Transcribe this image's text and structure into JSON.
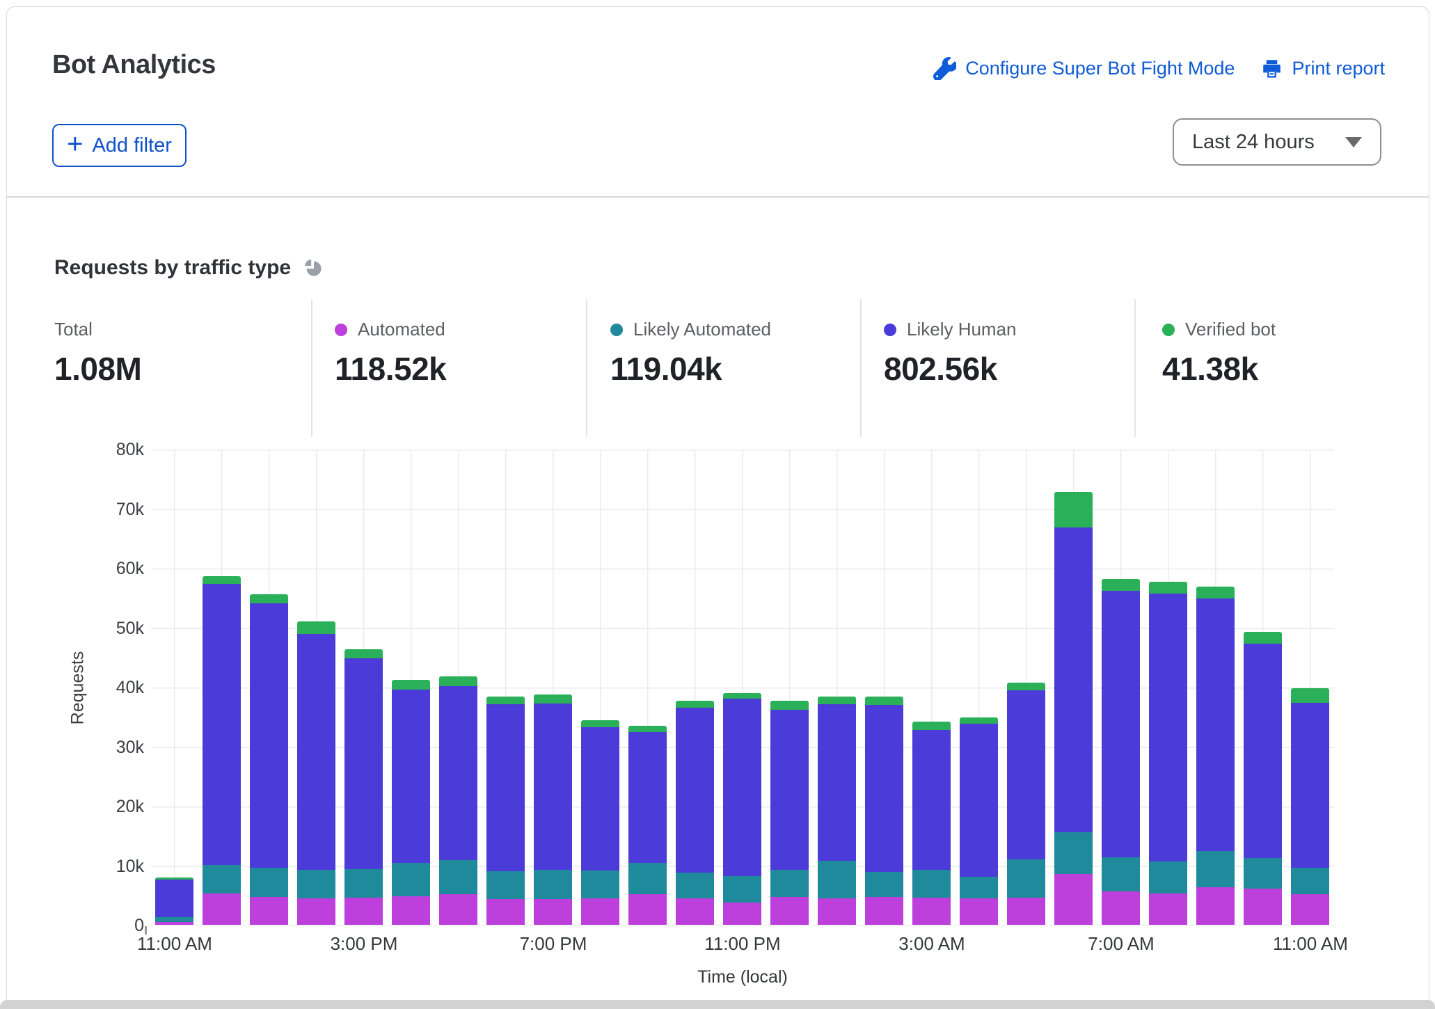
{
  "header": {
    "title": "Bot Analytics",
    "configure_link": "Configure Super Bot Fight Mode",
    "print_link": "Print report",
    "add_filter_label": "Add filter",
    "time_range": "Last 24 hours"
  },
  "section": {
    "title": "Requests by traffic type"
  },
  "stats": [
    {
      "label": "Total",
      "value": "1.08M",
      "dot": null
    },
    {
      "label": "Automated",
      "value": "118.52k",
      "dot": "#bd3fdc"
    },
    {
      "label": "Likely Automated",
      "value": "119.04k",
      "dot": "#1f8a9b"
    },
    {
      "label": "Likely Human",
      "value": "802.56k",
      "dot": "#4b3bd8"
    },
    {
      "label": "Verified bot",
      "value": "41.38k",
      "dot": "#2bb05a"
    }
  ],
  "colors": {
    "link_blue": "#0f5bd8",
    "grid": "#ebebeb",
    "pie_icon_gray": "#9aa0a5"
  },
  "chart_data": {
    "type": "bar",
    "stacked": true,
    "title": "Requests by traffic type",
    "xlabel": "Time (local)",
    "ylabel": "Requests",
    "ylim": [
      0,
      80000
    ],
    "yticks": [
      "0",
      "10k",
      "20k",
      "30k",
      "40k",
      "50k",
      "60k",
      "70k",
      "80k"
    ],
    "x_tick_labels": [
      "11:00 AM",
      "3:00 PM",
      "7:00 PM",
      "11:00 PM",
      "3:00 AM",
      "7:00 AM",
      "11:00 AM"
    ],
    "x_tick_positions": [
      0,
      4,
      8,
      12,
      16,
      20,
      24
    ],
    "bar_count": 25,
    "grid": true,
    "legend_position": "top-stats-row",
    "series": [
      {
        "name": "Automated",
        "color": "#bd3fdc",
        "values": [
          500,
          5300,
          4700,
          4500,
          4600,
          4800,
          5200,
          4300,
          4300,
          4400,
          5200,
          4500,
          3700,
          4700,
          4500,
          4700,
          4600,
          4500,
          4600,
          8500,
          5600,
          5300,
          6300,
          6100,
          5100
        ]
      },
      {
        "name": "Likely Automated",
        "color": "#1f8a9b",
        "values": [
          800,
          4800,
          4900,
          4700,
          4800,
          5600,
          5700,
          4700,
          4900,
          4700,
          5200,
          4300,
          4500,
          4600,
          6300,
          4200,
          4600,
          3600,
          6400,
          7000,
          5700,
          5400,
          6100,
          5100,
          4500
        ]
      },
      {
        "name": "Likely Human",
        "color": "#4b3bd8",
        "values": [
          6300,
          47200,
          44400,
          39700,
          35400,
          29100,
          29200,
          28100,
          28000,
          24100,
          22000,
          27700,
          29800,
          26900,
          26300,
          28100,
          23500,
          25700,
          28400,
          51300,
          44900,
          45000,
          42500,
          36100,
          27700
        ]
      },
      {
        "name": "Verified bot",
        "color": "#2bb05a",
        "values": [
          300,
          1300,
          1600,
          2100,
          1500,
          1700,
          1700,
          1300,
          1500,
          1200,
          1000,
          1200,
          1000,
          1500,
          1300,
          1400,
          1500,
          1100,
          1300,
          5900,
          1900,
          2000,
          2000,
          1900,
          2500
        ]
      }
    ]
  }
}
